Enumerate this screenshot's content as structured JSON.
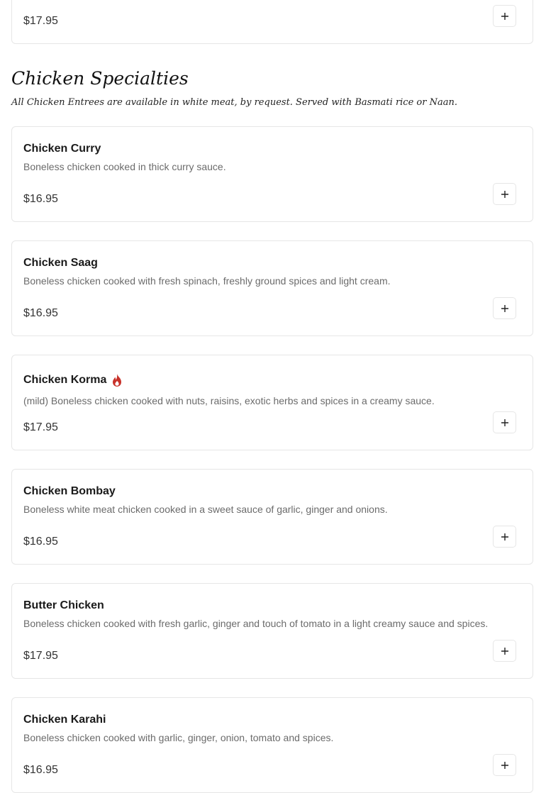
{
  "prev_item": {
    "price": "$17.95"
  },
  "section": {
    "title": "Chicken Specialties",
    "subtitle": "All Chicken Entrees are available in white meat, by request. Served with Basmati rice or Naan."
  },
  "items": [
    {
      "name": "Chicken Curry",
      "description": "Boneless chicken cooked in thick curry sauce.",
      "price": "$16.95"
    },
    {
      "name": "Chicken Saag",
      "description": "Boneless chicken cooked with fresh spinach, freshly ground spices and light cream.",
      "price": "$16.95"
    },
    {
      "name": "Chicken Korma",
      "description": "(mild) Boneless chicken cooked with nuts, raisins, exotic herbs and spices in a creamy sauce.",
      "price": "$17.95",
      "icon": "flame-icon"
    },
    {
      "name": "Chicken Bombay",
      "description": "Boneless white meat chicken cooked in a sweet sauce of garlic, ginger and onions.",
      "price": "$16.95"
    },
    {
      "name": "Butter Chicken",
      "description": "Boneless chicken cooked with fresh garlic, ginger and touch of tomato in a light creamy sauce and spices.",
      "price": "$17.95"
    },
    {
      "name": "Chicken Karahi",
      "description": "Boneless chicken cooked with garlic, ginger, onion, tomato and spices.",
      "price": "$16.95"
    }
  ],
  "icons": {
    "add": "plus-icon",
    "spicy": "flame-icon"
  },
  "colors": {
    "spicy": "#c8322a",
    "border": "#e6e6e6",
    "description": "#6b6b6b"
  }
}
